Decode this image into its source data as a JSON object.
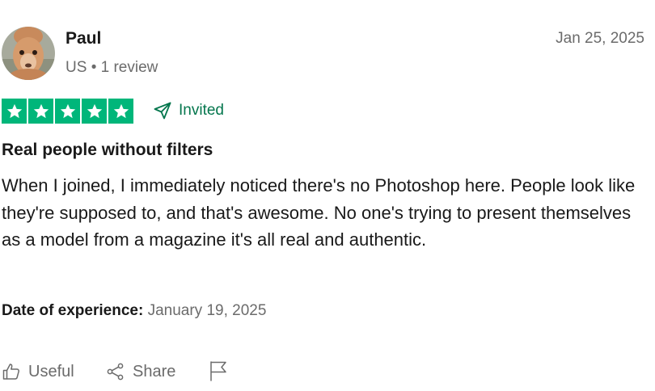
{
  "reviewer": {
    "name": "Paul",
    "country": "US",
    "separator": "•",
    "review_count": "1 review",
    "avatar_icon": "alpaca-avatar-photo"
  },
  "review": {
    "date": "Jan 25, 2025",
    "rating": 5,
    "rating_max": 5,
    "invited_label": "Invited",
    "title": "Real people without filters",
    "body": "When I joined, I immediately noticed there's no Photoshop here. People look like they're supposed to, and that's awesome. No one's trying to present themselves as a model from a magazine it's all real and authentic.",
    "experience_label": "Date of experience:",
    "experience_date": "January 19, 2025"
  },
  "actions": {
    "useful_label": "Useful",
    "share_label": "Share",
    "useful_icon": "thumbs-up-icon",
    "share_icon": "share-icon",
    "report_icon": "flag-icon"
  },
  "colors": {
    "star_green": "#00b67a",
    "invited_green": "#04764d",
    "text_primary": "#191919",
    "text_muted": "#6b6b6b"
  }
}
